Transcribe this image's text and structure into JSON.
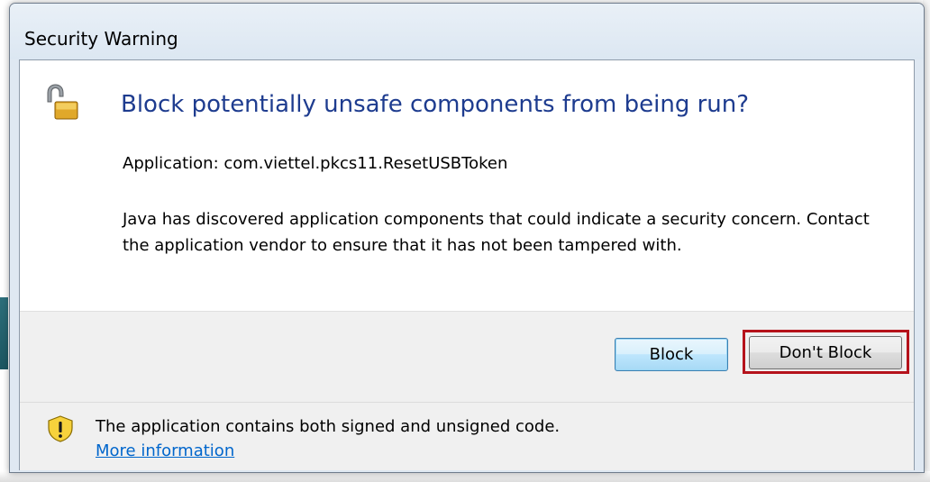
{
  "window": {
    "title": "Security Warning"
  },
  "main": {
    "heading": "Block potentially unsafe components from being run?",
    "application_line": "Application: com.viettel.pkcs11.ResetUSBToken",
    "description": "Java has discovered application components that could indicate a security concern. Contact the application vendor to ensure that it has not been tampered with.",
    "icon": "unlocked-padlock-icon"
  },
  "buttons": {
    "block_label": "Block",
    "dont_block_label": "Don't Block"
  },
  "footer": {
    "icon": "shield-warning-icon",
    "message": "The application contains both signed and unsigned code.",
    "link_text": "More information"
  },
  "colors": {
    "heading": "#1e3c8f",
    "link": "#0066cc",
    "highlight": "#b5121b"
  }
}
